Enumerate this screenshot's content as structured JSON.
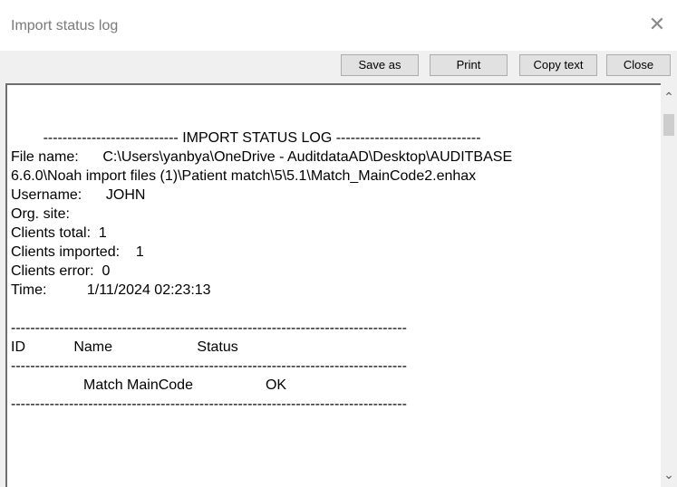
{
  "window": {
    "title": "Import status log",
    "close_glyph": "✕"
  },
  "toolbar": {
    "save_as": "Save as",
    "print": "Print",
    "copy_text": "Copy text",
    "close": "Close"
  },
  "log": {
    "header_line": "---------------------------- IMPORT STATUS LOG ------------------------------",
    "file_name_label": "File name:",
    "file_name_value_1": "C:\\Users\\yanbya\\OneDrive - AuditdataAD\\Desktop\\AUDITBASE",
    "file_name_value_2": "6.6.0\\Noah import files (1)\\Patient match\\5\\5.1\\Match_MainCode2.enhax",
    "username_label": "Username:",
    "username_value": "JOHN",
    "org_site_label": "Org. site:",
    "clients_total": "Clients total:  1",
    "clients_imported": "Clients imported:    1",
    "clients_error": "Clients error:  0",
    "time_label": "Time:",
    "time_value": "1/11/2024 02:23:13",
    "divider": "----------------------------------------------------------------------------------",
    "col_id": "ID",
    "col_name": "Name",
    "col_status": "Status",
    "row_name": "Match MainCode",
    "row_status": "OK"
  },
  "scrollbar": {
    "up_icon": "up-arrow",
    "down_icon": "down-arrow"
  }
}
